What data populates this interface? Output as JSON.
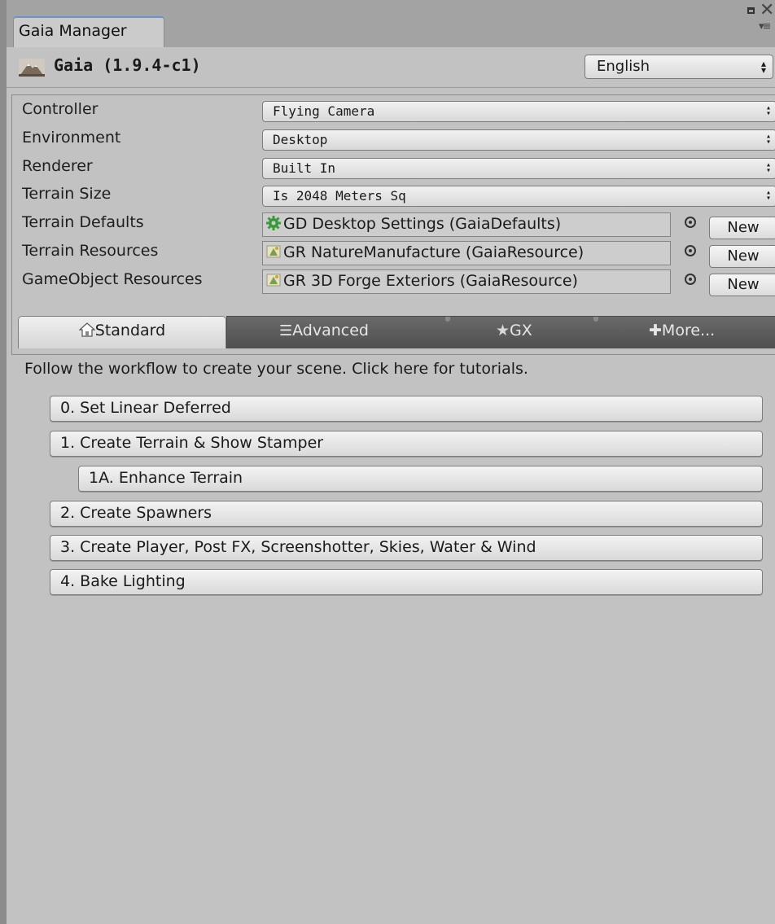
{
  "window": {
    "tab_title": "Gaia Manager"
  },
  "header": {
    "title": "Gaia (1.9.4-c1)",
    "language": "English"
  },
  "settings": {
    "controller": {
      "label": "Controller",
      "value": "Flying Camera"
    },
    "environment": {
      "label": "Environment",
      "value": "Desktop"
    },
    "renderer": {
      "label": "Renderer",
      "value": "Built In"
    },
    "terrain_size": {
      "label": "Terrain Size",
      "value": "Is 2048 Meters Sq"
    },
    "terrain_defaults": {
      "label": "Terrain Defaults",
      "value": "GD Desktop Settings (GaiaDefaults)",
      "button": "New"
    },
    "terrain_resources": {
      "label": "Terrain Resources",
      "value": "GR NatureManufacture (GaiaResource)",
      "button": "New"
    },
    "gameobject_resources": {
      "label": "GameObject Resources",
      "value": "GR 3D Forge Exteriors (GaiaResource)",
      "button": "New"
    }
  },
  "tabs": {
    "standard": "Standard",
    "advanced": "Advanced",
    "gx": "GX",
    "more": "More..."
  },
  "workflow": {
    "intro": "Follow the workflow to create your scene. Click here for tutorials.",
    "steps": [
      "0. Set Linear Deferred",
      "1. Create Terrain & Show Stamper",
      "1A. Enhance Terrain",
      "2. Create Spawners",
      "3. Create Player, Post FX, Screenshotter, Skies, Water & Wind",
      "4. Bake Lighting"
    ]
  },
  "colors": {
    "panel_bg": "#c2c2c2",
    "tab_strip_bg": "#a3a3a3",
    "dark_tab_bg": "#5c5c5c",
    "active_tab_accent": "#6a93c9",
    "settings_icon_green": "#3a9a3a"
  },
  "icons": {
    "app_logo": "gaia-mountain-logo",
    "standard_tab": "home-icon",
    "advanced_tab": "list-icon",
    "gx_tab": "star-icon",
    "more_tab": "plus-icon",
    "defaults_field": "gear-icon",
    "resource_field": "resource-icon",
    "object_picker": "object-picker-icon"
  }
}
